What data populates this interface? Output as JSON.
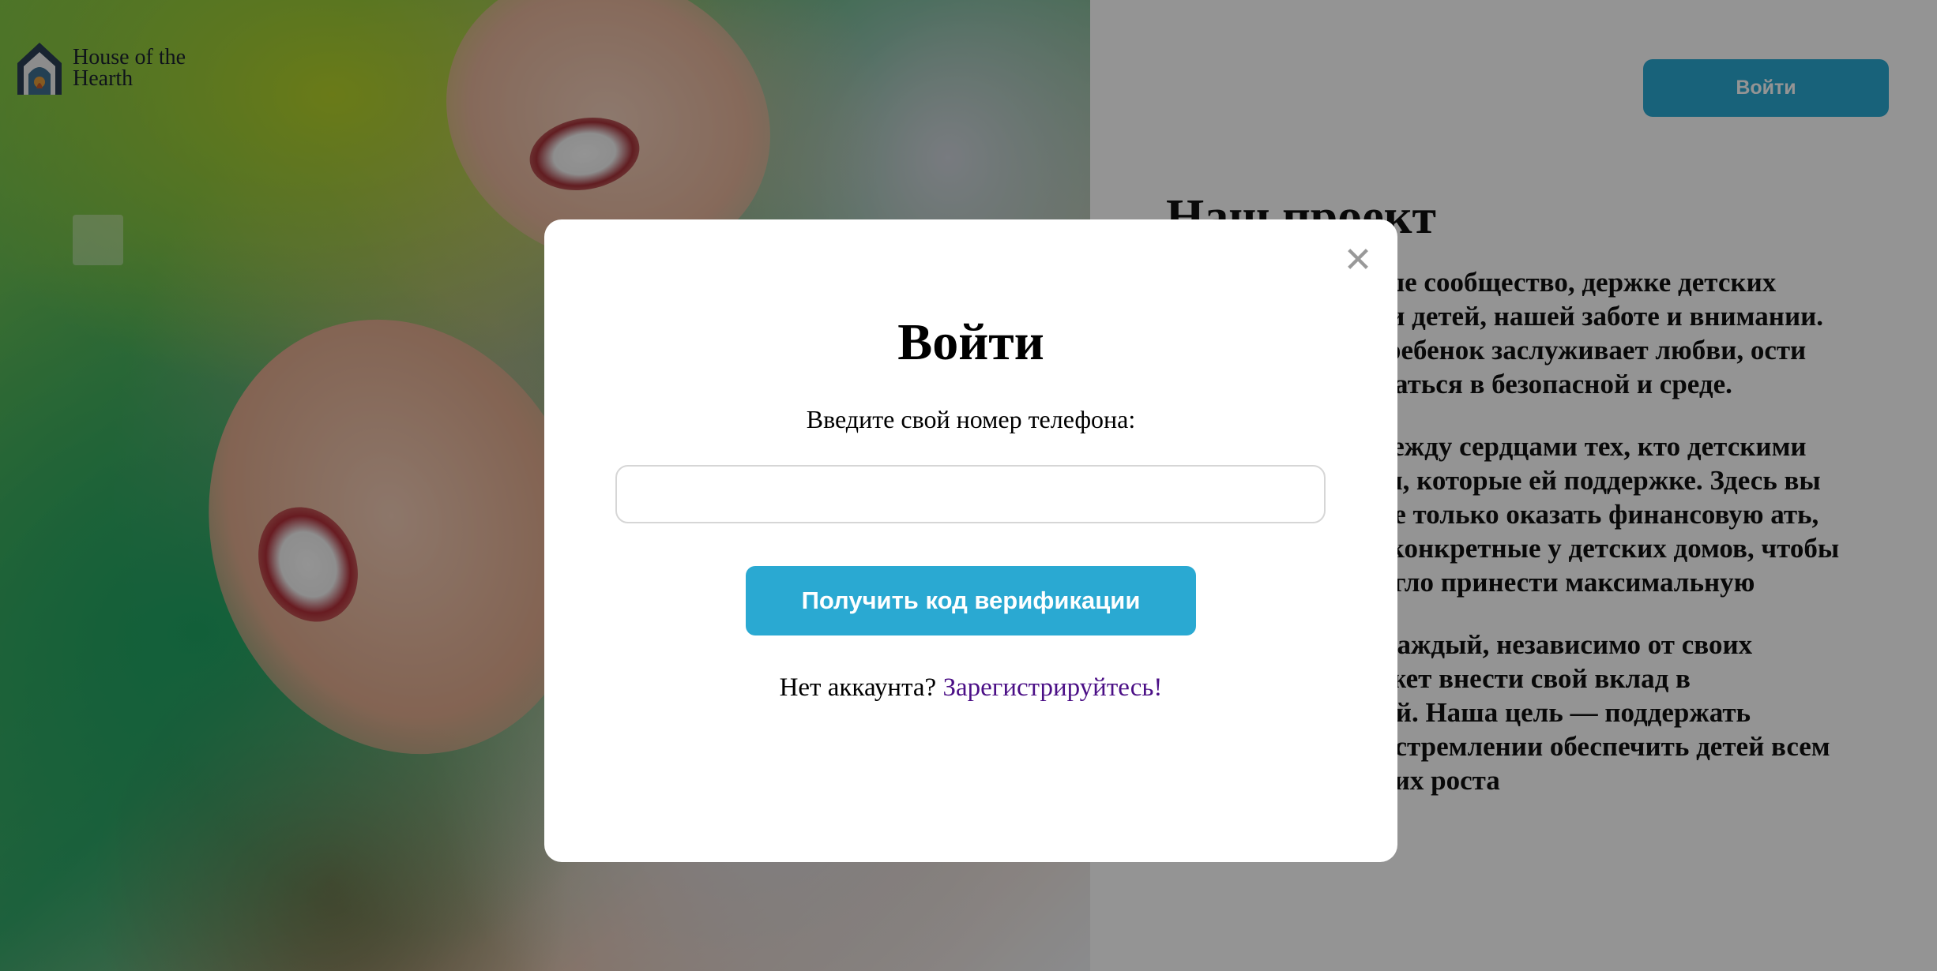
{
  "header": {
    "logo_line1": "House of the",
    "logo_line2": "Hearth",
    "login_button": "Войти"
  },
  "article": {
    "title": "Наш проект",
    "paragraphs": [
      "ь в наше сообщество, держке детских домов и детей, нашей заботе и внимании. Мы й ребенок заслуживает любви, ости развиваться в безопасной и среде.",
      "мост между сердцами тех, кто детскими домами, которые ей поддержке. Здесь вы найдете только оказать финансовую ать, какие конкретные у детских домов, чтобы ваше огло принести максимальную",
      "оздать место, где каждый, независимо от своих возможностей, может внести свой вклад в благополучие детей. Наша цель — поддержать детские дома в их стремлении обеспечить детей всем необходимым для их роста"
    ]
  },
  "modal": {
    "close_symbol": "✕",
    "title": "Войти",
    "phone_label": "Введите свой номер телефона:",
    "phone_value": "",
    "phone_placeholder": "",
    "verify_button": "Получить код верификации",
    "no_account_text": "Нет аккаунта?",
    "register_link": "Зарегистрируйтесь!"
  },
  "colors": {
    "accent": "#2aa9d2",
    "link": "#4b0f86",
    "overlay": "rgba(0,0,0,0.42)"
  }
}
